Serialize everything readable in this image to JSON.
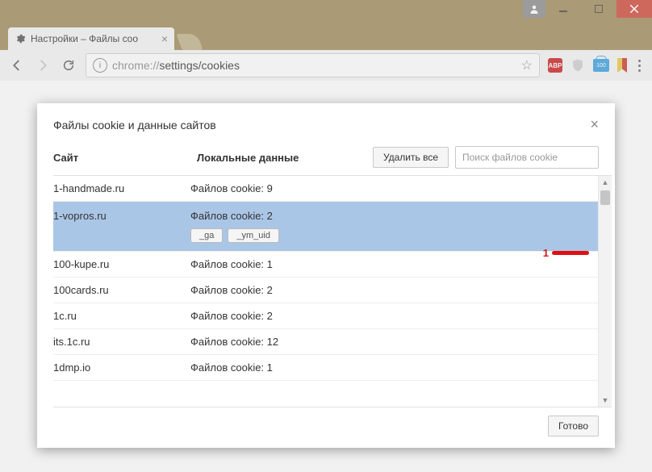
{
  "window": {
    "tab_title": "Настройки – Файлы coo"
  },
  "omnibox": {
    "scheme": "chrome://",
    "path": "settings/cookies"
  },
  "ext": {
    "abp": "ABP",
    "idm": "100"
  },
  "dialog": {
    "title": "Файлы cookie и данные сайтов",
    "col_site": "Сайт",
    "col_data": "Локальные данные",
    "delete_all": "Удалить все",
    "search_placeholder": "Поиск файлов cookie",
    "done": "Готово"
  },
  "rows": [
    {
      "site": "1-handmade.ru",
      "data": "Файлов cookie: 9"
    },
    {
      "site": "1-vopros.ru",
      "data": "Файлов cookie: 2",
      "selected": true,
      "chips": [
        "_ga",
        "_ym_uid"
      ]
    },
    {
      "site": "100-kupe.ru",
      "data": "Файлов cookie: 1"
    },
    {
      "site": "100cards.ru",
      "data": "Файлов cookie: 2"
    },
    {
      "site": "1c.ru",
      "data": "Файлов cookie: 2"
    },
    {
      "site": "its.1c.ru",
      "data": "Файлов cookie: 12"
    },
    {
      "site": "1dmp.io",
      "data": "Файлов cookie: 1"
    }
  ],
  "annotation": {
    "num": "1"
  }
}
